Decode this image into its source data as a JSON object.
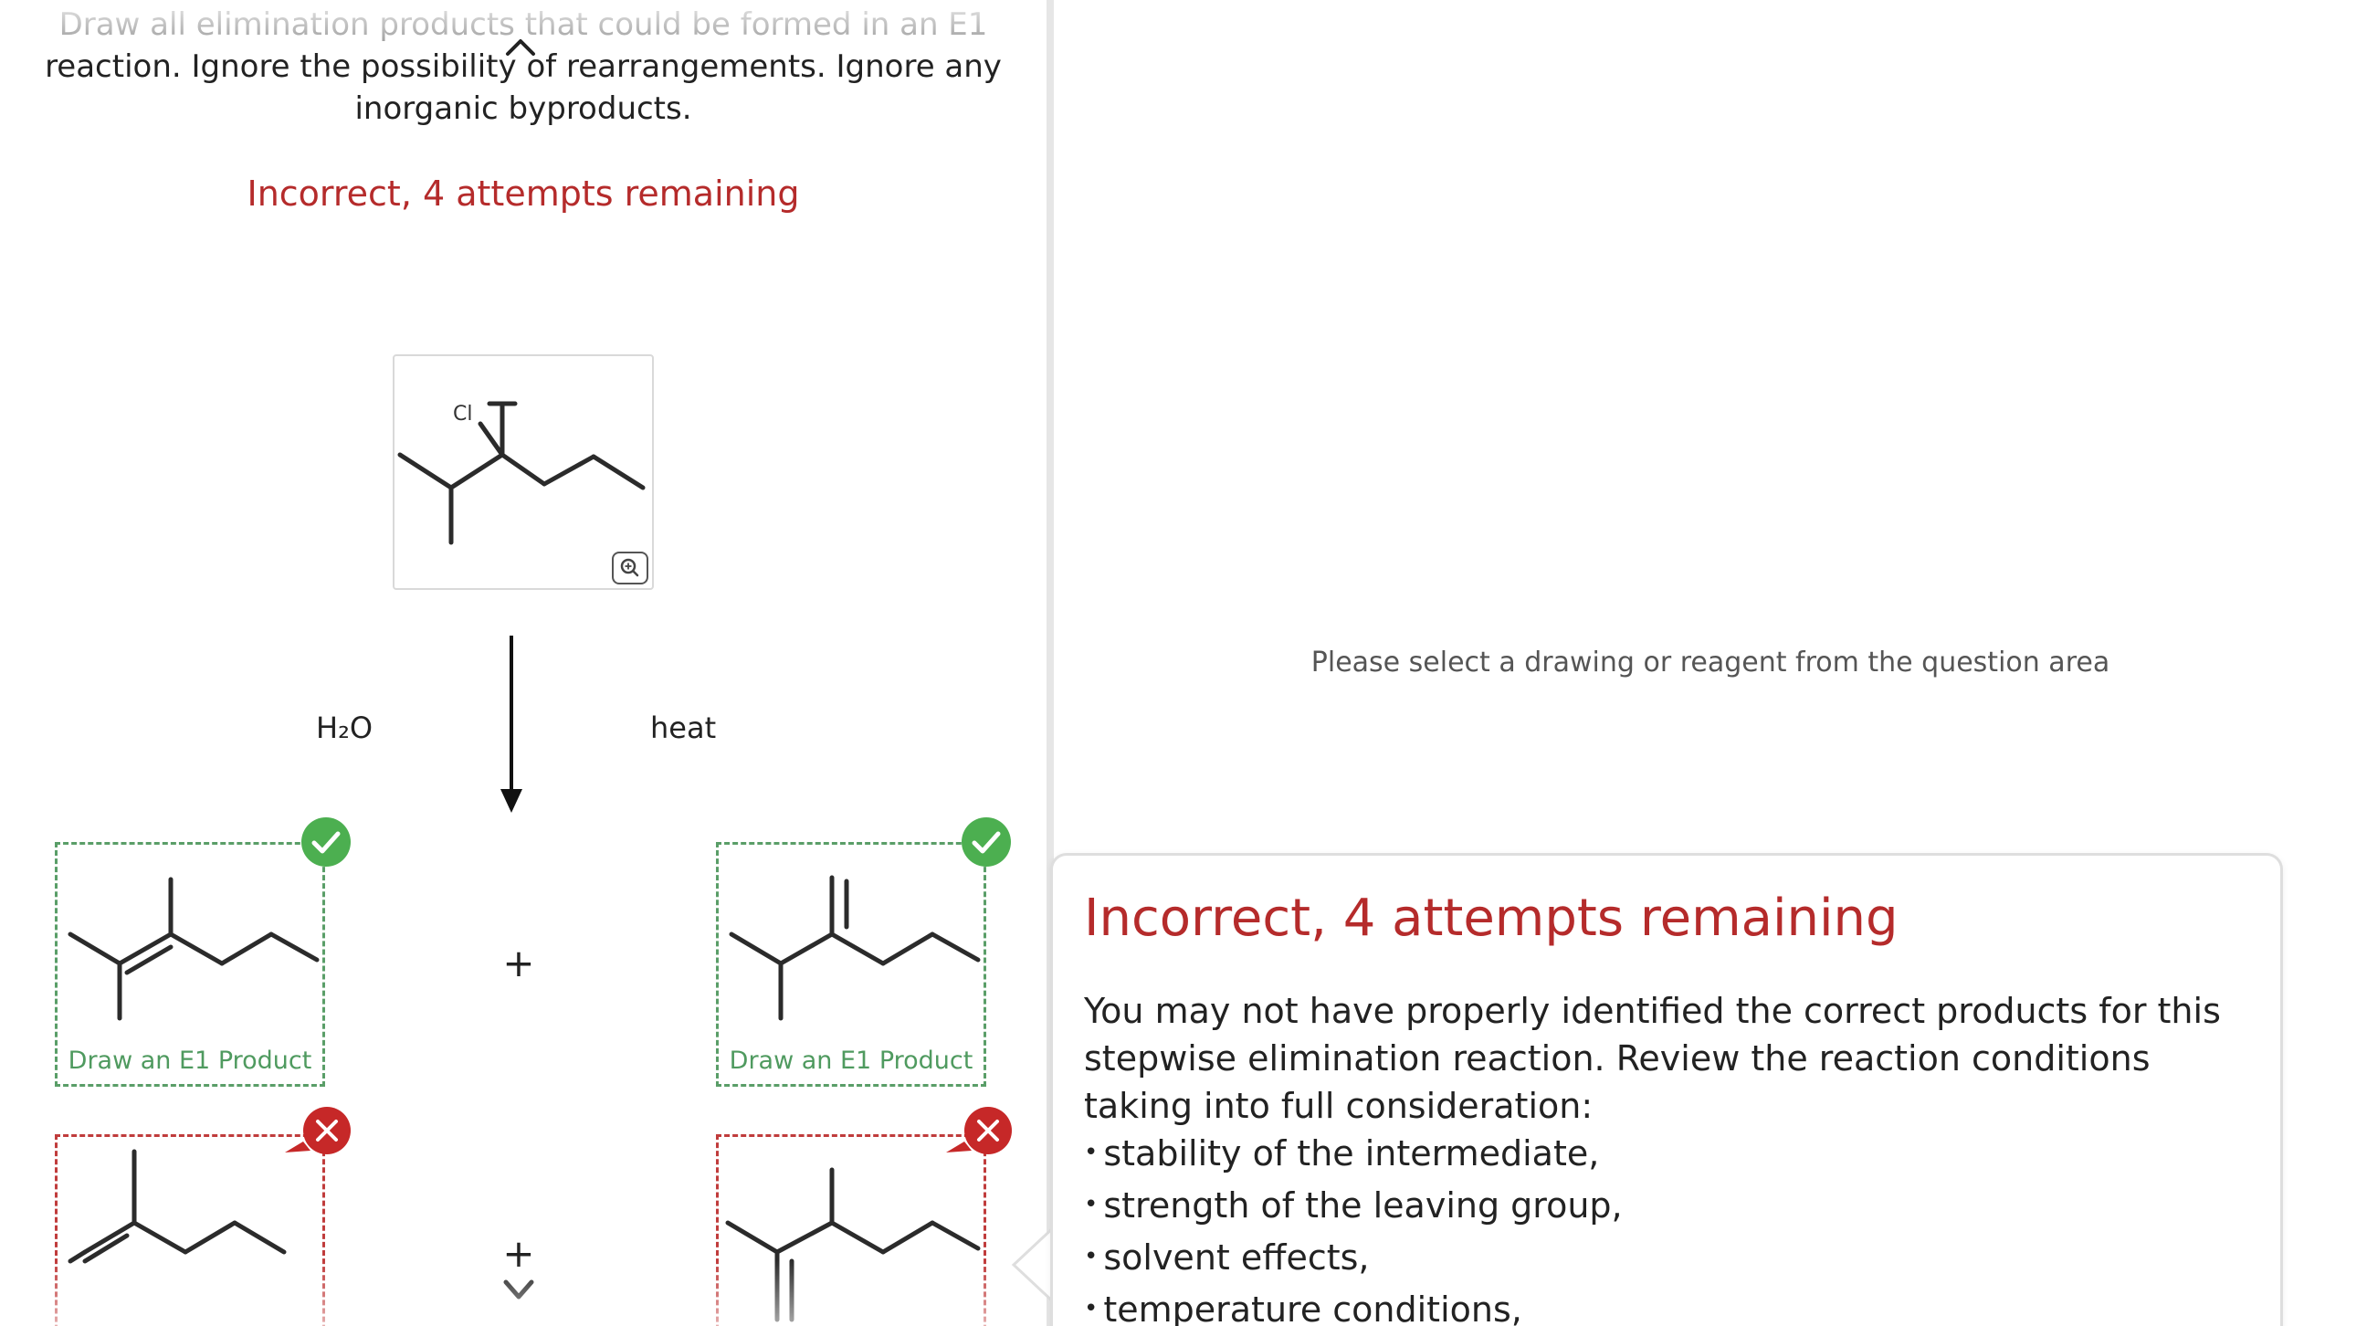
{
  "question": {
    "line1": "Draw all elimination products that could be formed in an E1",
    "line2": "reaction. Ignore the possibility of rearrangements. Ignore any",
    "line3": "inorganic byproducts.",
    "status": "Incorrect, 4 attempts remaining"
  },
  "reaction": {
    "leaving_group_label": "Cl",
    "reagent_left": "H₂O",
    "reagent_right": "heat",
    "plus": "+"
  },
  "products": [
    {
      "label": "Draw an E1 Product",
      "status": "correct"
    },
    {
      "label": "Draw an E1 Product",
      "status": "correct"
    },
    {
      "label": "",
      "status": "incorrect"
    },
    {
      "label": "",
      "status": "incorrect"
    }
  ],
  "workspace": {
    "hint": "Please select a drawing or reagent from the question area"
  },
  "feedback": {
    "title": "Incorrect, 4 attempts remaining",
    "body": "You may not have properly identified the correct products for this stepwise elimination reaction. Review the reaction conditions taking into full consideration:",
    "items": [
      "stability of the intermediate,",
      "strength of the leaving group,",
      "solvent effects,",
      "temperature conditions,"
    ]
  },
  "colors": {
    "error": "#b52b2b",
    "success": "#4f9a5f",
    "success_badge": "#4caf50",
    "error_badge": "#c62828",
    "bond": "#2b2b2b"
  },
  "icons": {
    "collapse": "chevron-up-icon",
    "zoom": "magnifier-icon",
    "correct": "checkmark-icon",
    "incorrect": "x-mark-icon",
    "scroll": "chevron-down-icon"
  }
}
